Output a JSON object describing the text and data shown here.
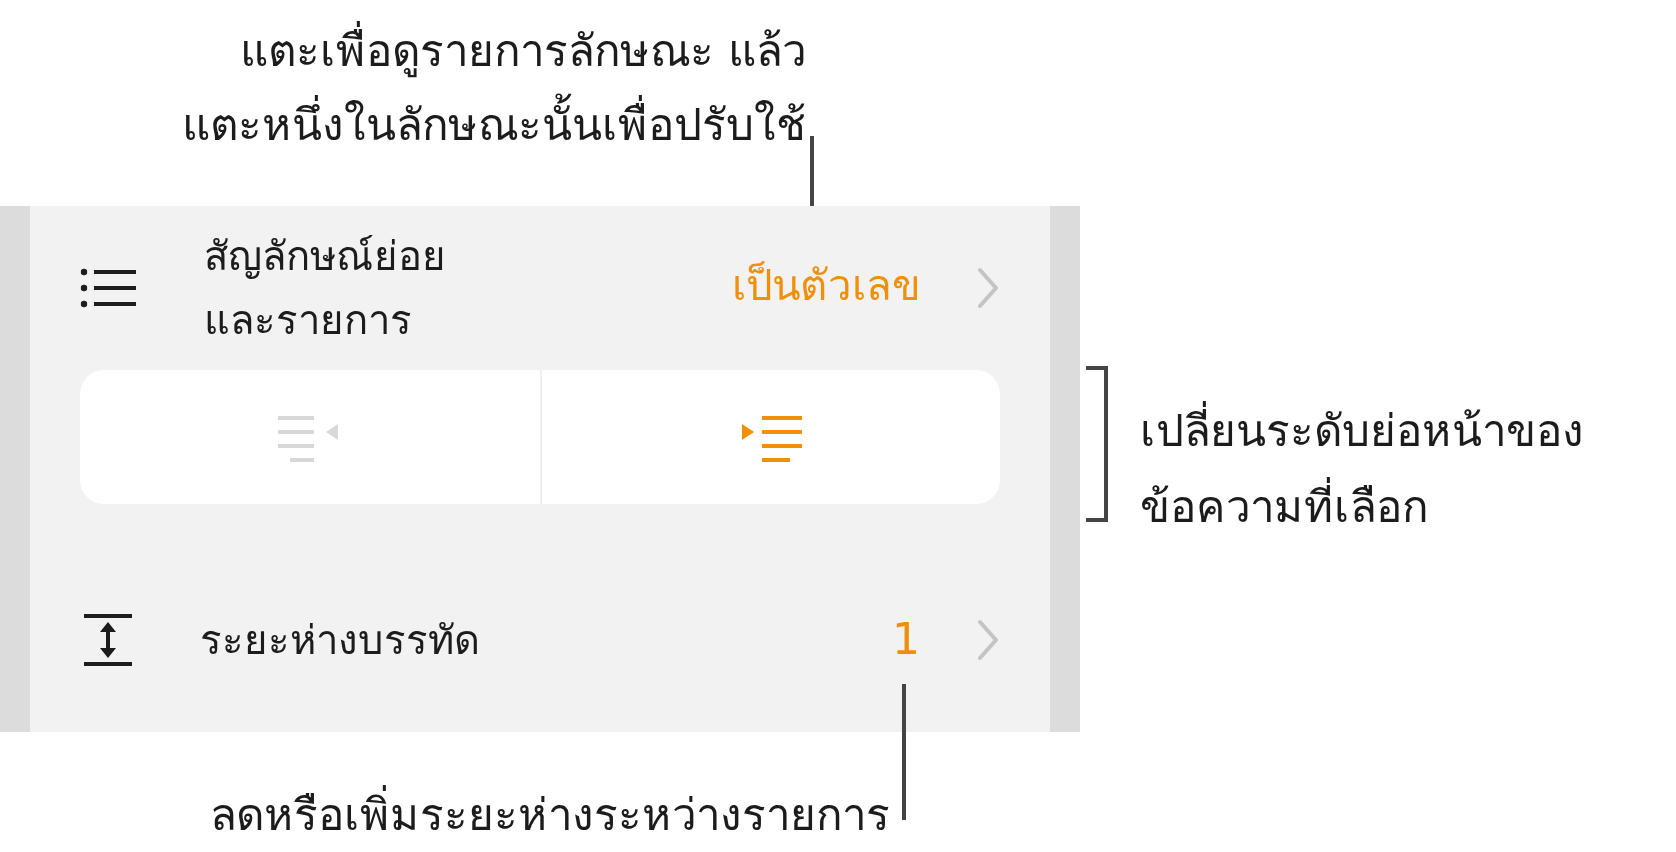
{
  "top_callout": {
    "text": "แตะเพื่อดูรายการลักษณะ แล้ว\nแตะหนึ่งในลักษณะนั้นเพื่อปรับใช้"
  },
  "panel": {
    "bullets_row": {
      "label": "สัญลักษณ์ย่อย\nและรายการ",
      "value": "เป็นตัวเลข"
    },
    "indent_buttons": [
      {
        "kind": "outdent",
        "disabled": true
      },
      {
        "kind": "indent",
        "disabled": false
      }
    ],
    "line_spacing_row": {
      "label": "ระยะห่างบรรทัด",
      "value": "1"
    }
  },
  "side_callout": {
    "text": "เปลี่ยนระดับย่อหน้าของ\nข้อความที่เลือก"
  },
  "bottom_callout": {
    "text": "ลดหรือเพิ่มระยะห่างระหว่างรายการ"
  }
}
